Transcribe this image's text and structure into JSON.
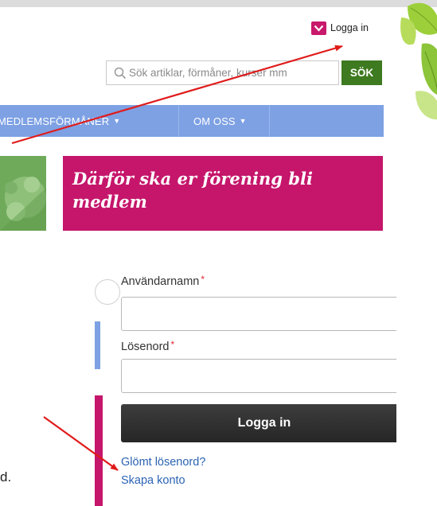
{
  "header": {
    "login_link": "Logga in",
    "search": {
      "placeholder": "Sök artiklar, förmåner, kurser mm",
      "button": "SÖK"
    }
  },
  "nav": {
    "items": [
      {
        "label": "MEDLEMSFÖRMÅNER",
        "icon": "caret-down-icon"
      },
      {
        "label": "OM OSS",
        "icon": "caret-down-icon"
      }
    ]
  },
  "promo": {
    "title": "Därför ska er förening bli medlem"
  },
  "login_form": {
    "username_label": "Användarnamn",
    "password_label": "Lösenord",
    "required_marker": "*",
    "submit": "Logga in",
    "forgot_password": "Glömt lösenord?",
    "create_account": "Skapa konto"
  },
  "stray_text": "d.",
  "colors": {
    "brand_pink": "#c5166b",
    "nav_blue": "#7ea1e4",
    "search_green": "#3e7a1f",
    "arrow_red": "#e01b1b",
    "link_blue": "#2b63b3"
  }
}
